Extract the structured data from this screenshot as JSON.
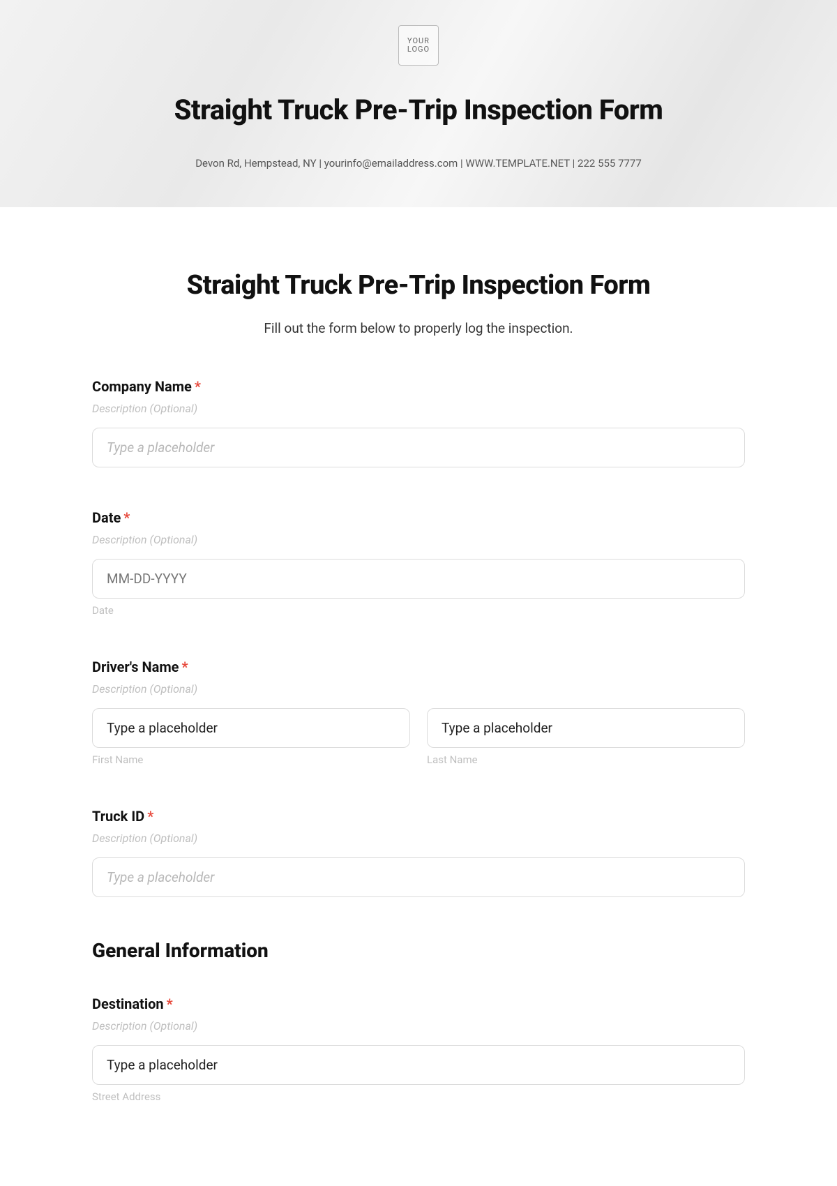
{
  "hero": {
    "logo_text": "YOUR\nLOGO",
    "title": "Straight Truck Pre-Trip Inspection Form",
    "contact": "Devon Rd, Hempstead, NY | yourinfo@emailaddress.com | WWW.TEMPLATE.NET | 222 555 7777"
  },
  "page": {
    "title": "Straight Truck Pre-Trip Inspection Form",
    "subtitle": "Fill out the form below to properly log the inspection."
  },
  "fields": {
    "company_name": {
      "label": "Company Name",
      "required_mark": "*",
      "description": "Description (Optional)",
      "placeholder": "Type a placeholder"
    },
    "date": {
      "label": "Date",
      "required_mark": "*",
      "description": "Description (Optional)",
      "placeholder": "MM-DD-YYYY",
      "sublabel": "Date"
    },
    "driver_name": {
      "label": "Driver's Name",
      "required_mark": "*",
      "description": "Description (Optional)",
      "first_placeholder": "Type a placeholder",
      "first_sublabel": "First Name",
      "last_placeholder": "Type a placeholder",
      "last_sublabel": "Last Name"
    },
    "truck_id": {
      "label": "Truck ID",
      "required_mark": "*",
      "description": "Description (Optional)",
      "placeholder": "Type a placeholder"
    }
  },
  "sections": {
    "general_info": {
      "heading": "General Information",
      "destination": {
        "label": "Destination",
        "required_mark": "*",
        "description": "Description (Optional)",
        "placeholder": "Type a placeholder",
        "sublabel": "Street Address"
      }
    }
  }
}
